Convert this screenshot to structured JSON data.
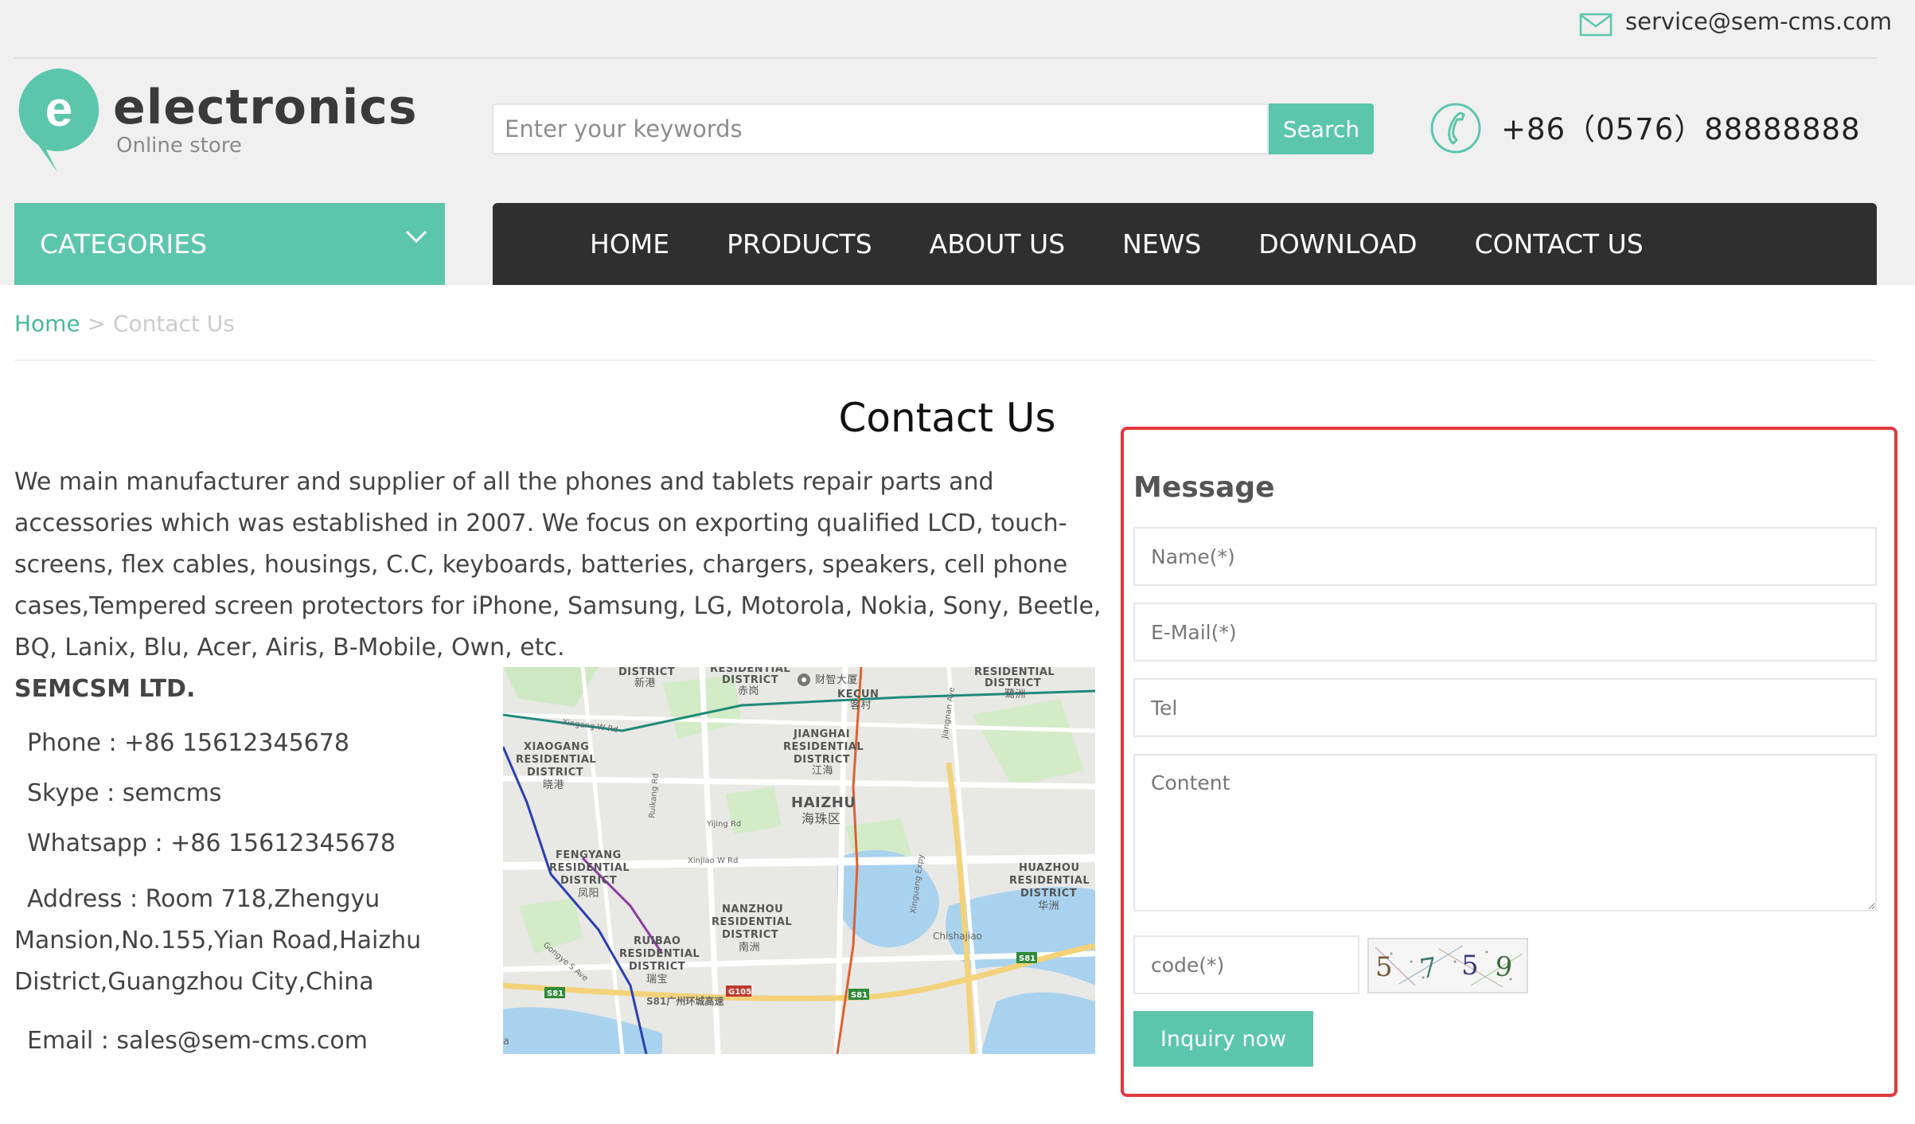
{
  "topbar": {
    "email": "service@sem-cms.com"
  },
  "brand": {
    "logo_letter": "e",
    "name": "electronics",
    "tagline": "Online store",
    "accent": "#5cc6ad"
  },
  "search": {
    "placeholder": "Enter your keywords",
    "button_label": "Search"
  },
  "header": {
    "phone": "+86（0576）88888888"
  },
  "categories": {
    "label": "CATEGORIES"
  },
  "nav": {
    "items": [
      "HOME",
      "PRODUCTS",
      "ABOUT US",
      "NEWS",
      "DOWNLOAD",
      "CONTACT US"
    ]
  },
  "breadcrumb": {
    "home": "Home",
    "separator": ">",
    "current": "Contact Us"
  },
  "page": {
    "title": "Contact Us",
    "intro": "We main manufacturer and supplier of all the phones and tablets repair parts and accessories which was established in 2007. We focus on exporting qualified LCD, touch-screens, flex cables, housings, C.C, keyboards, batteries, chargers, speakers, cell phone cases,Tempered screen protectors for iPhone, Samsung, LG, Motorola, Nokia, Sony, Beetle, BQ, Lanix, Blu, Acer, Airis, B-Mobile, Own, etc."
  },
  "company": {
    "name": "SEMCSM LTD.",
    "phone": "Phone : +86 15612345678",
    "skype": "Skype : semcms",
    "whatsapp": "Whatsapp : +86 15612345678",
    "address": "Address : Room 718,Zhengyu Mansion,No.155,Yian Road,Haizhu District,Guangzhou City,China",
    "email": "Email : sales@sem-cms.com"
  },
  "map": {
    "labels": {
      "district_top": "DISTRICT",
      "xingang": "新港",
      "residential_top": "RESIDENTIAL",
      "district_chigang": "DISTRICT",
      "chigang": "赤岗",
      "caizhi": "财智大厦",
      "kecun": "KECUN",
      "kecun_cn": "客村",
      "res_lujiang": "RESIDENTIAL",
      "dist_lujiang": "DISTRICT",
      "lujiang": "鹭洲",
      "xiaogang1": "XIAOGANG",
      "xiaogang2": "RESIDENTIAL",
      "xiaogang3": "DISTRICT",
      "xiaogang_cn": "晓港",
      "jianghai1": "JIANGHAI",
      "jianghai2": "RESIDENTIAL",
      "jianghai3": "DISTRICT",
      "jianghai_cn": "江海",
      "haizhu": "HAIZHU",
      "haizhu_cn": "海珠区",
      "fengyang1": "FENGYANG",
      "fengyang2": "RESIDENTIAL",
      "fengyang3": "DISTRICT",
      "fengyang_cn": "凤阳",
      "nanzhou1": "NANZHOU",
      "nanzhou2": "RESIDENTIAL",
      "nanzhou3": "DISTRICT",
      "nanzhou_cn": "南洲",
      "huazhou1": "HUAZHOU",
      "huazhou2": "RESIDENTIAL",
      "huazhou3": "DISTRICT",
      "huazhou_cn": "华洲",
      "ruibao1": "RUIBAO",
      "ruibao2": "RESIDENTIAL",
      "ruibao3": "DISTRICT",
      "ruibao_cn": "瑞宝",
      "xinjiao": "Xinjiao W Rd",
      "yijing": "Yijing Rd",
      "xingang_w": "Xingang W Rd",
      "xinguang": "Xinguang Expy",
      "chishajiao": "Chishajiao",
      "ring": "S81广州环城高速",
      "s81a": "S81",
      "s81b": "S81",
      "s81c": "S81",
      "g105": "G105",
      "ruikang": "Ruikang Rd",
      "gongye": "Gongye S Ave",
      "jiangnan": "Jiangnan Ave",
      "hedge": "a"
    }
  },
  "form": {
    "title": "Message",
    "name_placeholder": "Name(*)",
    "email_placeholder": "E-Mail(*)",
    "tel_placeholder": "Tel",
    "content_placeholder": "Content",
    "code_placeholder": "code(*)",
    "captcha_digits": [
      "5",
      "7",
      "5",
      "9"
    ],
    "submit_label": "Inquiry now",
    "highlight_color": "#e0393e"
  }
}
